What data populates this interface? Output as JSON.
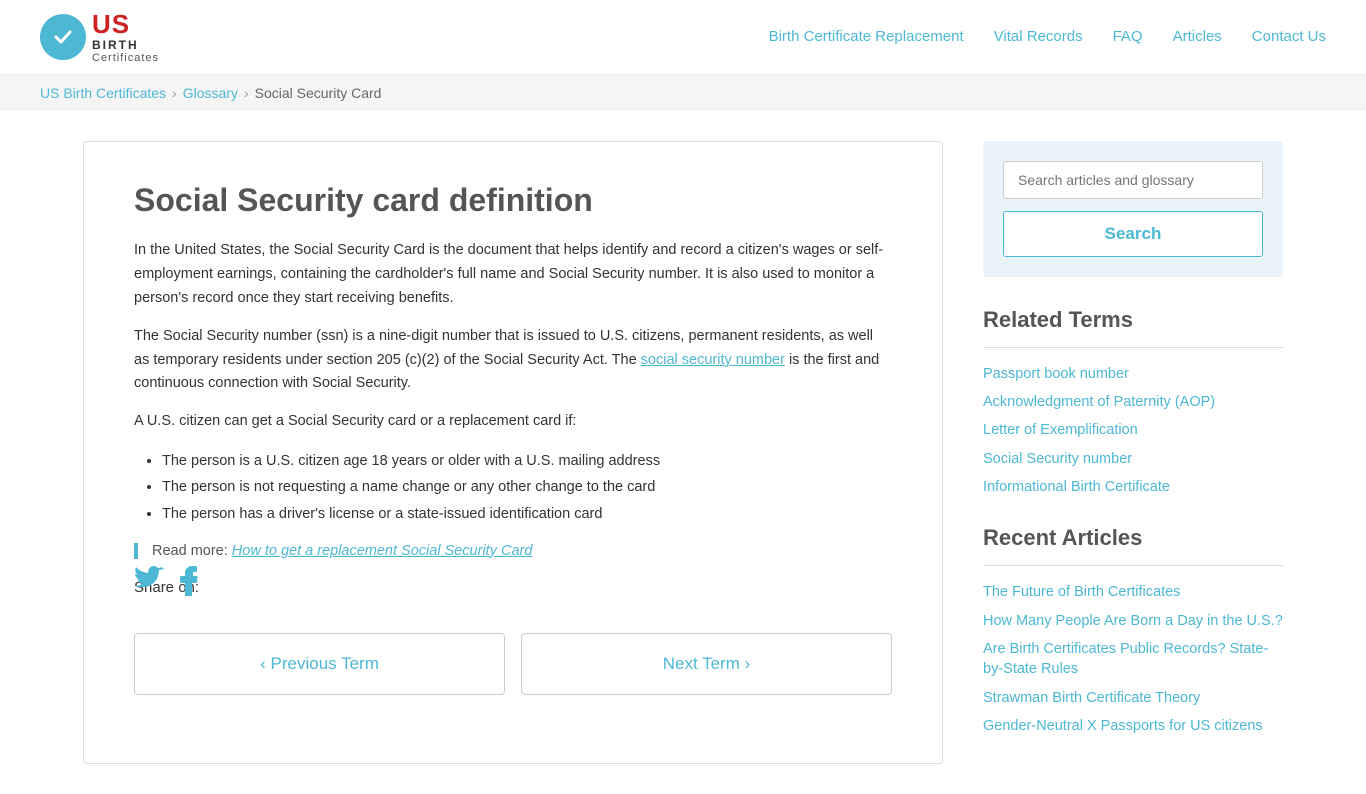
{
  "header": {
    "logo_us": "US",
    "logo_birth": "BIRTH",
    "logo_certs": "Certificates",
    "nav": [
      {
        "label": "Birth Certificate Replacement",
        "href": "#"
      },
      {
        "label": "Vital Records",
        "href": "#"
      },
      {
        "label": "FAQ",
        "href": "#"
      },
      {
        "label": "Articles",
        "href": "#"
      },
      {
        "label": "Contact Us",
        "href": "#"
      }
    ]
  },
  "breadcrumb": {
    "items": [
      {
        "label": "US Birth Certificates",
        "href": "#"
      },
      {
        "label": "Glossary",
        "href": "#"
      },
      {
        "label": "Social Security Card",
        "href": null
      }
    ]
  },
  "content": {
    "title": "Social Security card definition",
    "paragraphs": [
      "In the United States, the Social Security Card is the document that helps identify and record a citizen's wages or self-employment earnings, containing the cardholder's full name and Social Security number. It is also used to monitor a person's record once they start receiving benefits.",
      "The Social Security number (ssn) is a nine-digit number that is issued to U.S. citizens, permanent residents, as well as temporary residents under section 205 (c)(2) of the Social Security Act. The social security number is the first and continuous connection with Social Security.",
      "A U.S. citizen can get a Social Security card or a replacement card if:"
    ],
    "ssn_link_text": "social security number",
    "ssn_link_href": "#",
    "list_items": [
      "The person is a U.S. citizen age 18 years or older with a U.S. mailing address",
      "The person is not requesting a name change or any other change to the card",
      "The person has a driver's license or a state-issued identification card"
    ],
    "read_more_label": "Read more:",
    "read_more_link_text": "How to get a replacement Social Security Card",
    "read_more_link_href": "#",
    "share_label": "Share on:",
    "prev_btn": "‹  Previous Term",
    "next_btn": "Next Term  ›"
  },
  "sidebar": {
    "search_placeholder": "Search articles and glossary",
    "search_btn_label": "Search",
    "related_title": "Related Terms",
    "related_links": [
      {
        "label": "Passport book number",
        "href": "#"
      },
      {
        "label": "Acknowledgment of Paternity (AOP)",
        "href": "#"
      },
      {
        "label": "Letter of Exemplification",
        "href": "#"
      },
      {
        "label": "Social Security number",
        "href": "#"
      },
      {
        "label": "Informational Birth Certificate",
        "href": "#"
      }
    ],
    "recent_title": "Recent Articles",
    "recent_links": [
      {
        "label": "The Future of Birth Certificates",
        "href": "#"
      },
      {
        "label": "How Many People Are Born a Day in the U.S.?",
        "href": "#"
      },
      {
        "label": "Are Birth Certificates Public Records? State-by-State Rules",
        "href": "#"
      },
      {
        "label": "Strawman Birth Certificate Theory",
        "href": "#"
      },
      {
        "label": "Gender-Neutral X Passports for US citizens",
        "href": "#"
      }
    ]
  }
}
